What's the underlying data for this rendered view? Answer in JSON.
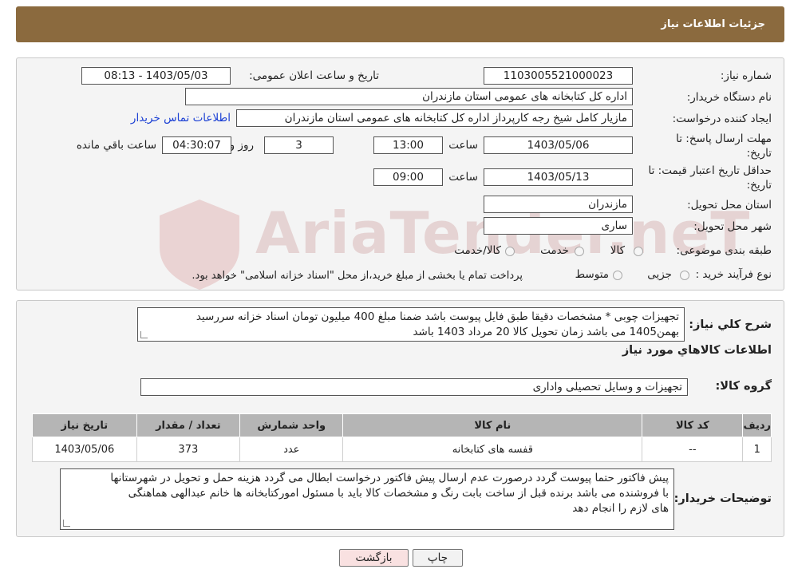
{
  "header": {
    "title": "جزئیات اطلاعات نیاز"
  },
  "watermark": {
    "text": "AriaTender.neT"
  },
  "form": {
    "need_number_label": "شماره نیاز:",
    "need_number": "1103005521000023",
    "announce_label": "تاریخ و ساعت اعلان عمومی:",
    "announce_value": "1403/05/03 - 08:13",
    "buyer_org_label": "نام دستگاه خریدار:",
    "buyer_org": "اداره کل کتابخانه های عمومی استان مازندران",
    "creator_label": "ایجاد کننده درخواست:",
    "creator": "مازیار کامل شیخ رجه کارپرداز اداره کل کتابخانه های عمومی استان مازندران",
    "contact_link": "اطلاعات تماس خریدار",
    "deadline_label_1": "مهلت ارسال پاسخ: تا",
    "deadline_label_2": "تاریخ:",
    "deadline_date": "1403/05/06",
    "time_label": "ساعت",
    "deadline_time": "13:00",
    "days_value": "3",
    "days_label": "روز و",
    "remaining_time": "04:30:07",
    "remaining_label": "ساعت باقي مانده",
    "validity_label_1": "حداقل تاریخ اعتبار قیمت: تا",
    "validity_label_2": "تاریخ:",
    "validity_date": "1403/05/13",
    "validity_time": "09:00",
    "province_label": "استان محل تحویل:",
    "province": "مازندران",
    "city_label": "شهر محل تحویل:",
    "city": "ساری",
    "category_label": "طبقه بندی موضوعی:",
    "category_options": [
      "کالا",
      "خدمت",
      "کالا/خدمت"
    ],
    "purchase_type_label": "نوع فرآیند خرید :",
    "purchase_options": [
      "جزیی",
      "متوسط"
    ],
    "purchase_note": "پرداخت تمام یا بخشی از مبلغ خرید،از محل \"اسناد خزانه اسلامی\" خواهد بود."
  },
  "details": {
    "summary_label": "شرح کلي نياز:",
    "summary_line1": "تجهیزات چوبی *  مشخصات دقیقا طبق فایل پیوست باشد ضمنا مبلغ 400 میلیون تومان اسناد خزانه سررسید",
    "summary_line2": "بهمن1405 می باشد زمان تحویل کالا 20 مرداد 1403 باشد",
    "goods_info_title": "اطلاعات کالاهاي مورد نياز",
    "goods_group_label": "گروه کالا:",
    "goods_group": "تجهیزات و وسایل تحصیلی واداری",
    "table": {
      "headers": [
        "رديف",
        "کد کالا",
        "نام کالا",
        "واحد شمارش",
        "تعداد / مقدار",
        "تاريخ نياز"
      ],
      "rows": [
        [
          "1",
          "--",
          "قفسه های کتابخانه",
          "عدد",
          "373",
          "1403/05/06"
        ]
      ]
    },
    "buyer_notes_label": "توضیحات خریدار:",
    "buyer_notes_line1": "پیش فاکتور حتما پیوست گردد درصورت عدم ارسال پیش فاکتور درخواست ابطال می گردد هزینه حمل و تحویل در شهرستانها",
    "buyer_notes_line2": "با فروشنده می باشد برنده قبل از ساخت بابت رنگ و مشخصات کالا باید با مسئول امورکتابخانه ها خانم عبدالهی هماهنگی",
    "buyer_notes_line3": "های لازم را انجام دهد"
  },
  "buttons": {
    "print": "چاپ",
    "back": "بازگشت"
  },
  "colors": {
    "header": "#8b6a3e",
    "back_button": "#f9e1e1",
    "link": "#1a3fd4"
  }
}
